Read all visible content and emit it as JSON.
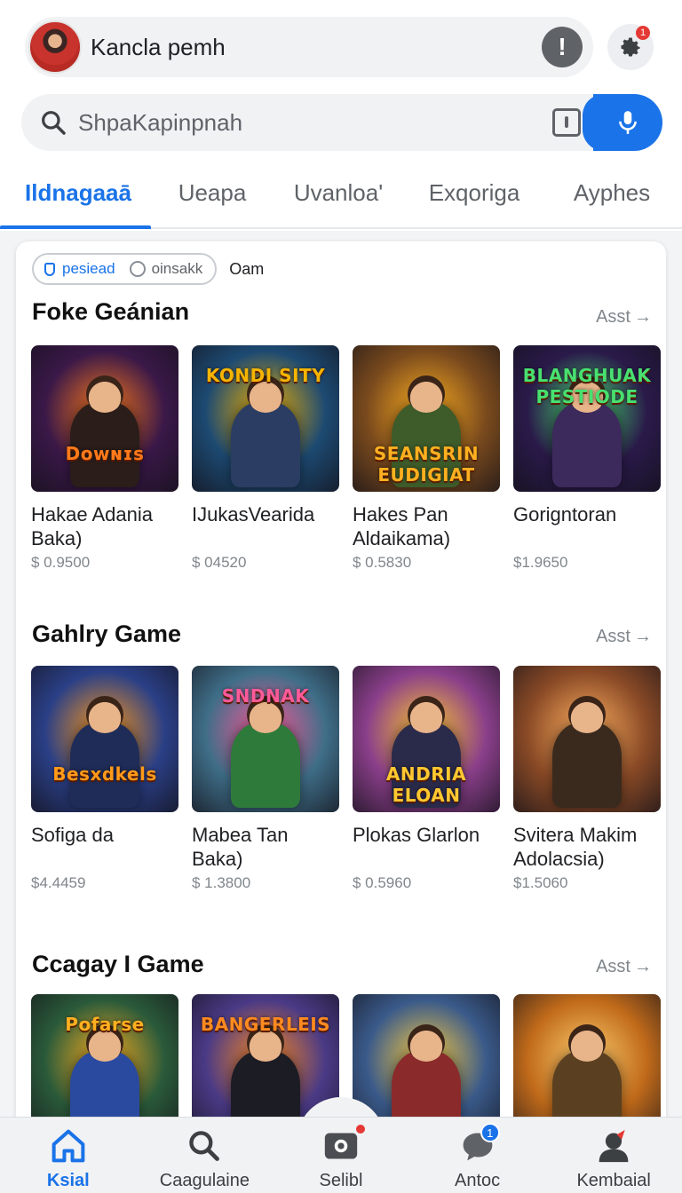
{
  "account": {
    "name": "Kancla pemh",
    "settings_badge": "1"
  },
  "search": {
    "placeholder": "ShpaKapinpnah"
  },
  "tabs": [
    {
      "label": "Ildnagaaā"
    },
    {
      "label": "Ueapa"
    },
    {
      "label": "Uvanloa'"
    },
    {
      "label": "Exqoriga"
    },
    {
      "label": "Ayphes"
    }
  ],
  "filters": {
    "chip_on": "pesiead",
    "chip_off": "oinsakk",
    "extra": "Oam"
  },
  "sections": [
    {
      "title": "Foke Geánian",
      "see_all": "Asst",
      "items": [
        {
          "title": "Hakae Adania Baka)",
          "price": "$ 0.9500",
          "logo": "Dᴏᴡɴɪs",
          "bg": "#3a1848",
          "accent": "#ff7a1a",
          "fig": "#2a1d1a"
        },
        {
          "title": "IJukasVearida",
          "price": "$ 04520",
          "logo": "KONDI SITY",
          "bg": "#1d4a72",
          "accent": "#f5b400",
          "fig": "#2b3d63"
        },
        {
          "title": "Hakes Pan Aldaikama)",
          "price": "$ 0.5830",
          "logo": "SEANSRIN EUDIGIAT",
          "bg": "#7a4a1d",
          "accent": "#ffb020",
          "fig": "#3e5b2a"
        },
        {
          "title": "Gorigntoran",
          "price": "$1.9650",
          "logo": "BLANGHUAK PESTIODE",
          "bg": "#2a1a4a",
          "accent": "#48e070",
          "fig": "#3c2a5c"
        }
      ]
    },
    {
      "title": "Gahlry Game",
      "see_all": "Asst",
      "items": [
        {
          "title": "Sofiga da",
          "price": "$4.4459",
          "logo": "Besxdkels",
          "bg": "#2a3f86",
          "accent": "#ff9a1a",
          "fig": "#1f2c58"
        },
        {
          "title": "Mabea Tan Baka)",
          "price": "$ 1.3800",
          "logo": "SNDNAK",
          "bg": "#3f6e88",
          "accent": "#ff5a9a",
          "fig": "#2e7a3a"
        },
        {
          "title": "Plokas Glarlon",
          "price": "$ 0.5960",
          "logo": "ANDRIA ELOAN",
          "bg": "#8a3f8a",
          "accent": "#ffc830",
          "fig": "#2a2a4a"
        },
        {
          "title": "Svitera Makim Adolacsia)",
          "price": "$1.5060",
          "logo": "",
          "bg": "#8a4a26",
          "accent": "#ffb060",
          "fig": "#3a2a1e"
        }
      ]
    },
    {
      "title": "Ccagay I Game",
      "see_all": "Asst",
      "items": [
        {
          "title": "",
          "price": "",
          "logo": "Pofarse",
          "bg": "#2a5a3a",
          "accent": "#ffb020",
          "fig": "#2a4aa0"
        },
        {
          "title": "",
          "price": "",
          "logo": "BANGERLEIS",
          "bg": "#4a3a86",
          "accent": "#ff8a20",
          "fig": "#1c1c24"
        },
        {
          "title": "",
          "price": "",
          "logo": "",
          "bg": "#3a5a8a",
          "accent": "#ffce40",
          "fig": "#8a2a2a"
        },
        {
          "title": "",
          "price": "",
          "logo": "",
          "bg": "#c06a1a",
          "accent": "#ffd070",
          "fig": "#5a4020"
        }
      ]
    }
  ],
  "bottom_nav": [
    {
      "label": "Ksial",
      "icon": "home-icon",
      "active": true
    },
    {
      "label": "Caagulaine",
      "icon": "search-icon",
      "active": false
    },
    {
      "label": "Selibl",
      "icon": "camera-icon",
      "active": false
    },
    {
      "label": "Antoc",
      "icon": "chat-icon",
      "active": false,
      "badge": "1"
    },
    {
      "label": "Kembaial",
      "icon": "profile-icon",
      "active": false
    }
  ],
  "colors": {
    "accent": "#1a73e8",
    "badge": "#e53935"
  }
}
